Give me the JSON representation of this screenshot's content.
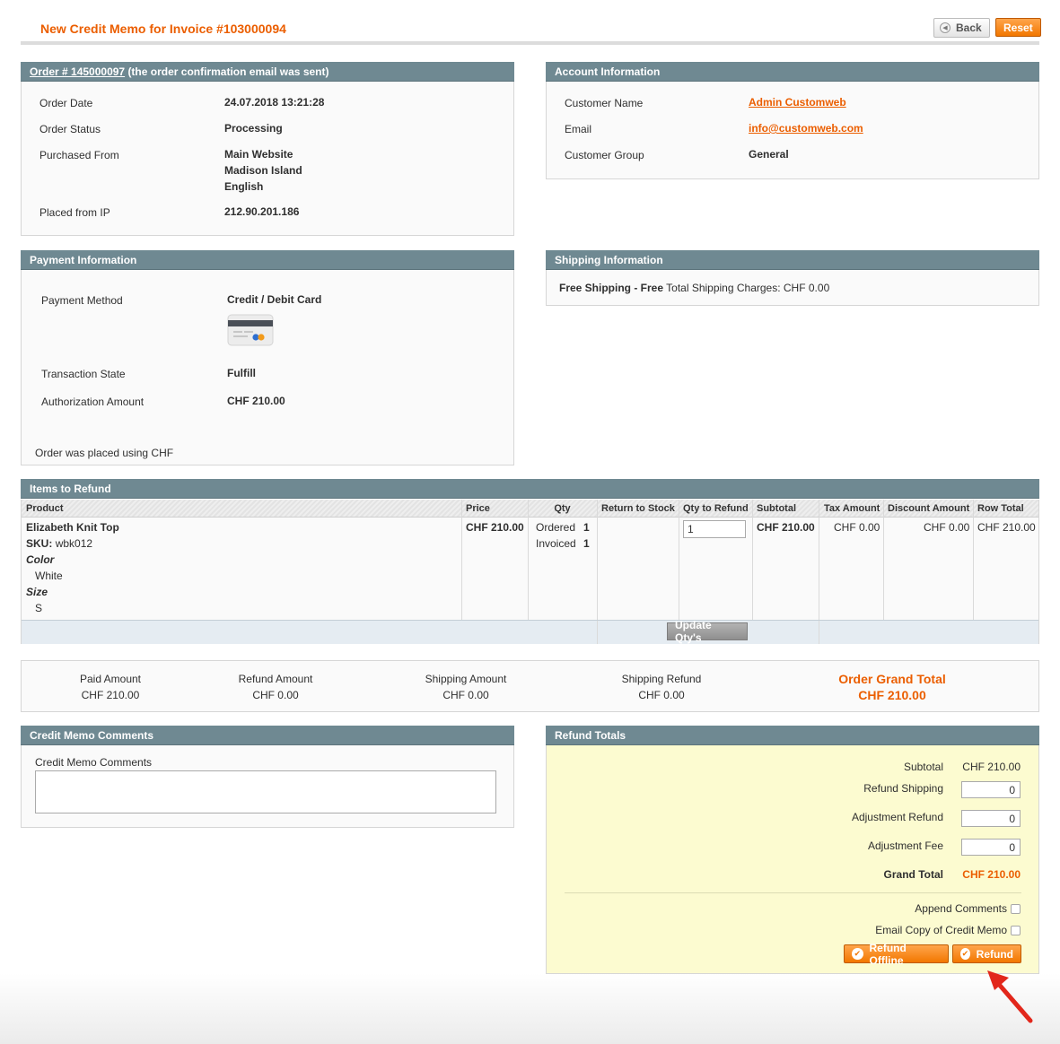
{
  "page": {
    "title": "New Credit Memo for Invoice #103000094",
    "back_label": "Back",
    "reset_label": "Reset"
  },
  "order_box": {
    "order_link": "Order # 145000097",
    "header_suffix": "(the order confirmation email was sent)",
    "rows": [
      {
        "label": "Order Date",
        "value": "24.07.2018 13:21:28"
      },
      {
        "label": "Order Status",
        "value": "Processing"
      },
      {
        "label": "Purchased From",
        "values": [
          "Main Website",
          "Madison Island",
          "English"
        ]
      },
      {
        "label": "Placed from IP",
        "value": "212.90.201.186"
      }
    ]
  },
  "account_box": {
    "title": "Account Information",
    "customer_name_label": "Customer Name",
    "customer_name": "Admin Customweb",
    "email_label": "Email",
    "email": "info@customweb.com",
    "group_label": "Customer Group",
    "group": "General"
  },
  "payment_box": {
    "title": "Payment Information",
    "method_label": "Payment Method",
    "method": "Credit / Debit Card",
    "transaction_label": "Transaction State",
    "transaction": "Fulfill",
    "auth_label": "Authorization Amount",
    "auth_amount": "CHF 210.00",
    "currency_note": "Order was placed using CHF"
  },
  "shipping_box": {
    "title": "Shipping Information",
    "method_bold": "Free Shipping - Free",
    "charges": "Total Shipping Charges: CHF 0.00"
  },
  "items": {
    "title": "Items to Refund",
    "columns": [
      "Product",
      "Price",
      "Qty",
      "Return to Stock",
      "Qty to Refund",
      "Subtotal",
      "Tax Amount",
      "Discount Amount",
      "Row Total"
    ],
    "row": {
      "name": "Elizabeth Knit Top",
      "sku_label": "SKU:",
      "sku": "wbk012",
      "opt1_label": "Color",
      "opt1_value": "White",
      "opt2_label": "Size",
      "opt2_value": "S",
      "price": "CHF 210.00",
      "ordered_label": "Ordered",
      "ordered": "1",
      "invoiced_label": "Invoiced",
      "invoiced": "1",
      "qty_to_refund": "1",
      "subtotal": "CHF 210.00",
      "tax": "CHF 0.00",
      "discount": "CHF 0.00",
      "row_total": "CHF 210.00"
    },
    "update_label": "Update Qty's"
  },
  "summary": {
    "paid_label": "Paid Amount",
    "paid": "CHF 210.00",
    "refund_label": "Refund Amount",
    "refund": "CHF 0.00",
    "shipping_label": "Shipping Amount",
    "shipping": "CHF 0.00",
    "shipping_refund_label": "Shipping Refund",
    "shipping_refund": "CHF 0.00",
    "grand_label": "Order Grand Total",
    "grand": "CHF 210.00"
  },
  "comments": {
    "title": "Credit Memo Comments",
    "field_label": "Credit Memo Comments"
  },
  "refund_totals": {
    "title": "Refund Totals",
    "subtotal_label": "Subtotal",
    "subtotal": "CHF 210.00",
    "shipping_label": "Refund Shipping",
    "shipping": "0",
    "adj_refund_label": "Adjustment Refund",
    "adj_refund": "0",
    "adj_fee_label": "Adjustment Fee",
    "adj_fee": "0",
    "grand_label": "Grand Total",
    "grand": "CHF 210.00",
    "append_label": "Append Comments",
    "email_copy_label": "Email Copy of Credit Memo",
    "refund_offline_label": "Refund Offline",
    "refund_label": "Refund"
  },
  "colors": {
    "accent_orange": "#eb5e00",
    "header_slate": "#6f8992",
    "totals_bg": "#fcfbd0",
    "pointer_red": "#e2271b"
  },
  "icons": [
    "back-arrow-icon",
    "credit-card-icon",
    "check-circle-icon",
    "red-pointer-arrow-icon"
  ]
}
